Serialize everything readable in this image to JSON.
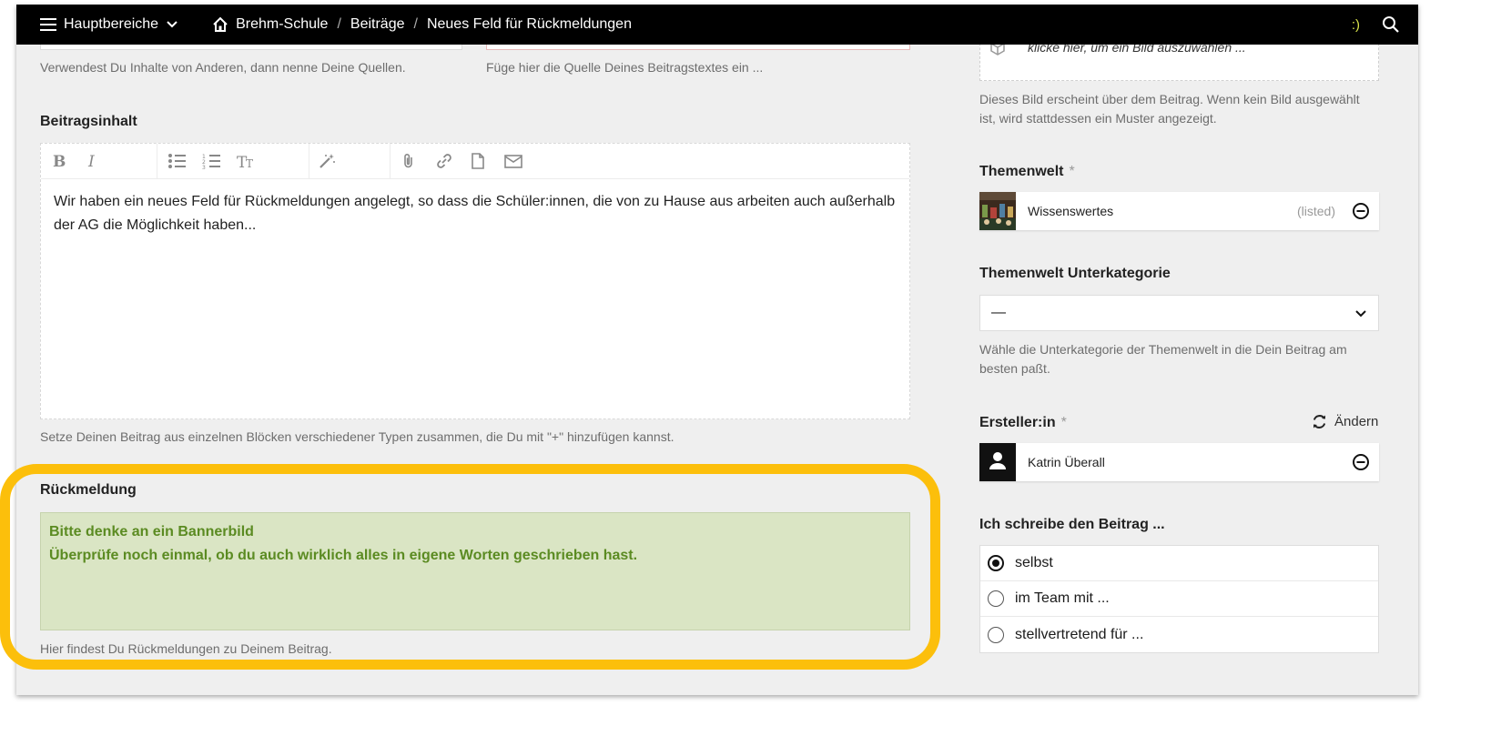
{
  "topbar": {
    "menu_label": "Hauptbereiche",
    "breadcrumbs": [
      "Brehm-Schule",
      "Beiträge",
      "Neues Feld für Rückmeldungen"
    ],
    "breadcrumb_separator": "/",
    "status_emoticon": ":)"
  },
  "sources": {
    "left_hint": "Verwendest Du Inhalte von Anderen, dann nenne Deine Quellen.",
    "right_hint": "Füge hier die Quelle Deines Beitragstextes ein ..."
  },
  "content": {
    "label": "Beitragsinhalt",
    "text": "Wir haben ein neues Feld für Rückmeldungen angelegt, so dass die Schüler:innen, die von zu Hause aus arbeiten auch außerhalb der AG die Möglichkeit haben...",
    "hint": "Setze Deinen Beitrag aus einzelnen Blöcken verschiedener Typen zusammen, die Du mit \"+\" hinzufügen kannst."
  },
  "feedback": {
    "label": "Rückmeldung",
    "lines": [
      "Bitte denke an ein Bannerbild",
      "Überprüfe noch einmal, ob du auch wirklich alles in eigene Worten geschrieben hast."
    ],
    "hint": "Hier findest Du Rückmeldungen zu Deinem Beitrag."
  },
  "image": {
    "placeholder": "klicke hier, um ein Bild auszuwählen ...",
    "hint": "Dieses Bild erscheint über dem Beitrag. Wenn kein Bild ausgewählt ist, wird stattdessen ein Muster angezeigt."
  },
  "theme_world": {
    "label": "Themenwelt",
    "required_mark": "*",
    "item_name": "Wissenswertes",
    "item_status": "(listed)"
  },
  "subcategory": {
    "label": "Themenwelt Unterkategorie",
    "selected": "—",
    "hint": "Wähle die Unterkategorie der Themenwelt in die Dein Beitrag am besten paßt."
  },
  "author": {
    "label": "Ersteller:in",
    "required_mark": "*",
    "change_label": "Ändern",
    "name": "Katrin Überall"
  },
  "writing_mode": {
    "label": "Ich schreibe den Beitrag ...",
    "options": [
      "selbst",
      "im Team mit ...",
      "stellvertretend für ..."
    ],
    "selected_index": 0
  },
  "colors": {
    "highlight": "#fcbf0b",
    "feedback_bg": "#dae5c4",
    "feedback_text": "#5b8b22"
  }
}
